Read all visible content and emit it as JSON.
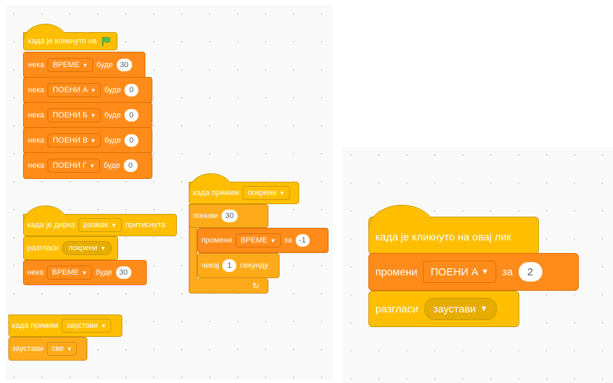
{
  "scripts": {
    "flag_script": {
      "hat_label": "када је кликнуто на",
      "rows": [
        {
          "kw": "нека",
          "var": "ВРЕМЕ",
          "op": "буде",
          "val": "30"
        },
        {
          "kw": "нека",
          "var": "ПОЕНИ А",
          "op": "буде",
          "val": "0"
        },
        {
          "kw": "нека",
          "var": "ПОЕНИ Б",
          "op": "буде",
          "val": "0"
        },
        {
          "kw": "нека",
          "var": "ПОЕНИ В",
          "op": "буде",
          "val": "0"
        },
        {
          "kw": "нека",
          "var": "ПОЕНИ Г",
          "op": "буде",
          "val": "0"
        }
      ]
    },
    "key_script": {
      "hat_pre": "када је дирка",
      "key": "размак",
      "hat_post": "притиснута",
      "broadcast_kw": "разгласи",
      "broadcast_msg": "покрени",
      "set_kw": "нека",
      "set_var": "ВРЕМЕ",
      "set_op": "буде",
      "set_val": "30"
    },
    "stop_script": {
      "hat_label": "када примим",
      "msg": "заустави",
      "stop_kw": "заустави",
      "stop_opt": "све"
    },
    "receive_script": {
      "hat_label": "када примим",
      "msg": "покрени",
      "repeat_kw": "понови",
      "repeat_val": "30",
      "change_kw": "промени",
      "change_var": "ВРЕМЕ",
      "change_by": "за",
      "change_val": "-1",
      "wait_kw": "чекај",
      "wait_val": "1",
      "wait_unit": "секунду",
      "loop_arrow": "↻"
    },
    "sprite_script": {
      "hat_label": "када је кликнуто на овај лик",
      "change_kw": "промени",
      "change_var": "ПОЕНИ А",
      "change_by": "за",
      "change_val": "2",
      "broadcast_kw": "разгласи",
      "broadcast_msg": "заустави"
    }
  },
  "icons": {
    "flag": "green-flag-icon",
    "caret": "dropdown-caret-icon"
  },
  "colors": {
    "variables": "#ff8c1a",
    "events": "#ffbf00",
    "control": "#ffab19",
    "flag_green": "#4cbf56"
  }
}
